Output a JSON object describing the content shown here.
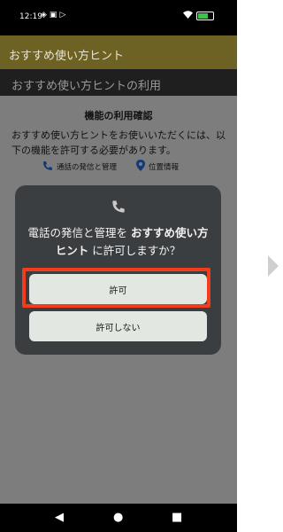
{
  "status_bar": {
    "time": "12:19",
    "left_icons": [
      "settings-icon",
      "lock-icon",
      "play-icon"
    ],
    "right_icons": [
      "wifi-icon",
      "battery-icon"
    ],
    "battery_level": 0.7,
    "battery_color": "#3ec24b"
  },
  "header": {
    "title": "おすすめ使い方ヒント",
    "background": "#6d6224"
  },
  "sub_header": {
    "title": "おすすめ使い方ヒントの利用"
  },
  "content": {
    "heading": "機能の利用確認",
    "description": "おすすめ使い方ヒントをお使いいただくには、以下の機能を許可する必要があります。",
    "permissions": [
      {
        "icon": "phone-icon",
        "label": "通話の発信と管理"
      },
      {
        "icon": "location-icon",
        "label": "位置情報"
      }
    ]
  },
  "dialog": {
    "icon": "phone-icon",
    "message_pre": "電話の発信と管理を ",
    "message_app": "おすすめ使い方ヒント",
    "message_post": " に許可しますか？",
    "allow_label": "許可",
    "deny_label": "許可しない",
    "highlight_color": "#f23c1b"
  },
  "nav_bar": {
    "buttons": [
      "back-icon",
      "home-icon",
      "recents-icon"
    ]
  },
  "side": {
    "next_icon": "chevron-right-icon"
  }
}
